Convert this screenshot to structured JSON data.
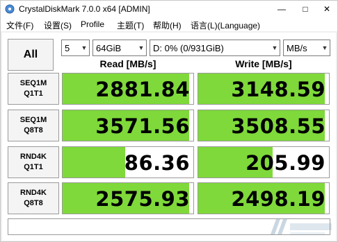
{
  "window": {
    "title": "CrystalDiskMark 7.0.0 x64 [ADMIN]"
  },
  "menu": [
    {
      "label": "文件(F)"
    },
    {
      "label": "设置(S)"
    },
    {
      "label": "Profile"
    },
    {
      "label": "主题(T)"
    },
    {
      "label": "帮助(H)"
    },
    {
      "label": "语言(L)(Language)"
    }
  ],
  "controls": {
    "all_label": "All",
    "count": "5",
    "size": "64GiB",
    "drive": "D: 0% (0/931GiB)",
    "unit": "MB/s"
  },
  "headers": {
    "read": "Read [MB/s]",
    "write": "Write [MB/s]"
  },
  "tests": [
    {
      "line1": "SEQ1M",
      "line2": "Q1T1",
      "read": "2881.84",
      "write": "3148.59",
      "read_fill": 0.97,
      "write_fill": 0.97
    },
    {
      "line1": "SEQ1M",
      "line2": "Q8T8",
      "read": "3571.56",
      "write": "3508.55",
      "read_fill": 0.97,
      "write_fill": 0.97
    },
    {
      "line1": "RND4K",
      "line2": "Q1T1",
      "read": "86.36",
      "write": "205.99",
      "read_fill": 0.48,
      "write_fill": 0.57
    },
    {
      "line1": "RND4K",
      "line2": "Q8T8",
      "read": "2575.93",
      "write": "2498.19",
      "read_fill": 0.97,
      "write_fill": 0.97
    }
  ],
  "comment": "",
  "colors": {
    "bar": "#7fd93a",
    "title_bg": "#ffffff"
  }
}
